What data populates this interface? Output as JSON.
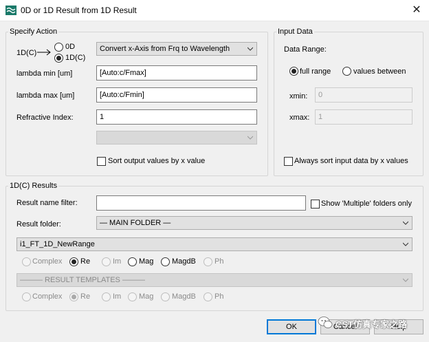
{
  "window": {
    "title": "0D or 1D Result from 1D Result",
    "close": "✕"
  },
  "specify_action": {
    "legend": "Specify Action",
    "mode_label": "1D(C)",
    "radio_0d": "0D",
    "radio_1dc": "1D(C)",
    "action_combo": "Convert x-Axis from Frq to Wavelength",
    "lambda_min_label": "lambda min [um]",
    "lambda_min_value": "[Auto:c/Fmax]",
    "lambda_max_label": "lambda max [um]",
    "lambda_max_value": "[Auto:c/Fmin]",
    "refractive_label": "Refractive Index:",
    "refractive_value": "1",
    "sort_output_label": "Sort output values by x value"
  },
  "input_data": {
    "legend": "Input Data",
    "range_label": "Data Range:",
    "full_range": "full range",
    "values_between": "values between",
    "xmin_label": "xmin:",
    "xmin_value": "0",
    "xmax_label": "xmax:",
    "xmax_value": "1",
    "always_sort_label": "Always sort input data by x values"
  },
  "results": {
    "legend": "1D(C) Results",
    "name_filter_label": "Result name filter:",
    "name_filter_value": "",
    "show_multiple_label": "Show 'Multiple' folders only",
    "folder_label": "Result folder:",
    "folder_value": "— MAIN FOLDER —",
    "result_value": "i1_FT_1D_NewRange",
    "templates_value": "——— RESULT TEMPLATES ———",
    "radios": [
      "Complex",
      "Re",
      "Im",
      "Mag",
      "MagdB",
      "Ph"
    ]
  },
  "buttons": {
    "ok": "OK",
    "cancel": "Cancel",
    "help": "Help"
  },
  "watermark": {
    "text": "CST仿真专家之路"
  }
}
